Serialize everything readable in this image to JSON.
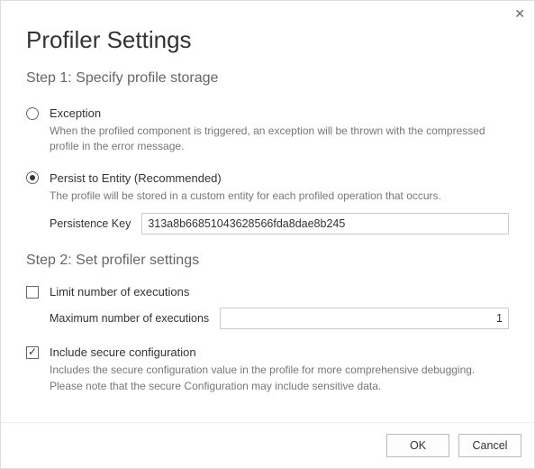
{
  "title": "Profiler Settings",
  "close_glyph": "✕",
  "step1": {
    "heading": "Step 1: Specify profile storage",
    "exception": {
      "label": "Exception",
      "desc": "When the profiled component is triggered, an exception will be thrown with the compressed profile in the error message."
    },
    "persist": {
      "label": "Persist to Entity (Recommended)",
      "desc": "The profile will be stored in a custom entity for each profiled operation that occurs.",
      "key_label": "Persistence Key",
      "key_value": "313a8b66851043628566fda8dae8b245"
    }
  },
  "step2": {
    "heading": "Step 2: Set profiler settings",
    "limit": {
      "label": "Limit number of executions",
      "max_label": "Maximum number of executions",
      "max_value": "1"
    },
    "secure": {
      "label": "Include secure configuration",
      "desc": "Includes the secure configuration value in the profile for more comprehensive debugging. Please note that the secure Configuration may include sensitive data."
    }
  },
  "footer": {
    "ok": "OK",
    "cancel": "Cancel"
  }
}
